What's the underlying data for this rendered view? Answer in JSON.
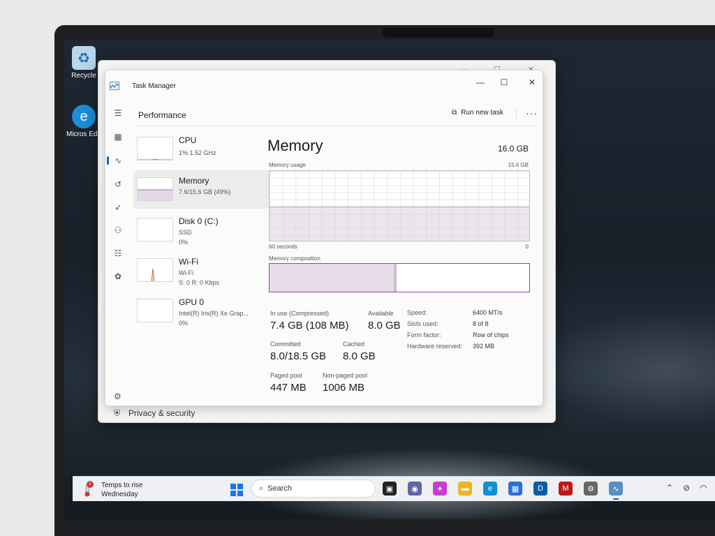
{
  "desktop": {
    "icons": [
      {
        "label": "Recycle",
        "icon": "recycle-bin-icon"
      },
      {
        "label": "Micros Edg",
        "icon": "edge-icon"
      }
    ]
  },
  "ghost_window": {
    "footer_label": "Privacy & security",
    "footer_icon": "shield-icon"
  },
  "window": {
    "title": "Task Manager",
    "app_icon": "task-manager-icon",
    "controls": [
      "minimize-icon",
      "maximize-icon",
      "close-icon"
    ]
  },
  "header": {
    "title": "Performance",
    "run_new_task": "Run new task",
    "more": "···"
  },
  "nav": [
    {
      "name": "hamburger-menu-icon",
      "glyph": "☰"
    },
    {
      "name": "processes-icon",
      "glyph": "▦"
    },
    {
      "name": "performance-icon",
      "glyph": "∿",
      "active": true
    },
    {
      "name": "app-history-icon",
      "glyph": "↺"
    },
    {
      "name": "startup-apps-icon",
      "glyph": "➶"
    },
    {
      "name": "users-icon",
      "glyph": "⚇"
    },
    {
      "name": "details-icon",
      "glyph": "☷"
    },
    {
      "name": "services-icon",
      "glyph": "✿"
    }
  ],
  "settings_icon": "⚙",
  "sidebar": [
    {
      "name": "CPU",
      "line1": "1%  1.52 GHz",
      "line2": ""
    },
    {
      "name": "Memory",
      "line1": "7.6/15.6 GB (49%)",
      "line2": "",
      "selected": true
    },
    {
      "name": "Disk 0 (C:)",
      "line1": "SSD",
      "line2": "0%"
    },
    {
      "name": "Wi-Fi",
      "line1": "Wi-Fi",
      "line2": "S: 0  R: 0 Kbps"
    },
    {
      "name": "GPU 0",
      "line1": "Intel(R) Iris(R) Xe Grap...",
      "line2": "0%"
    }
  ],
  "memory": {
    "title": "Memory",
    "total": "16.0 GB",
    "usage_label": "Memory usage",
    "usage_max": "15.6 GB",
    "usage_fraction": 0.49,
    "time_label": "60 seconds",
    "zero_label": "0",
    "composition_label": "Memory composition",
    "composition_used_fraction": 0.49,
    "stats": {
      "in_use_label": "In use (Compressed)",
      "in_use_value": "7.4 GB (108 MB)",
      "available_label": "Available",
      "available_value": "8.0 GB",
      "committed_label": "Committed",
      "committed_value": "8.0/18.5 GB",
      "cached_label": "Cached",
      "cached_value": "8.0 GB",
      "paged_label": "Paged pool",
      "paged_value": "447 MB",
      "nonpaged_label": "Non-paged pool",
      "nonpaged_value": "1006 MB"
    },
    "specs": [
      {
        "label": "Speed:",
        "value": "6400 MT/s"
      },
      {
        "label": "Slots used:",
        "value": "8 of 8"
      },
      {
        "label": "Form factor:",
        "value": "Row of chips"
      },
      {
        "label": "Hardware reserved:",
        "value": "392 MB"
      }
    ]
  },
  "taskbar": {
    "weather_line1": "Temps to rise",
    "weather_line2": "Wednesday",
    "weather_badge": "1",
    "search_placeholder": "Search",
    "apps": [
      {
        "name": "task-view-icon",
        "color": "#222"
      },
      {
        "name": "teams-icon",
        "color": "#6264a7"
      },
      {
        "name": "copilot-icon",
        "color": "#c43fd1"
      },
      {
        "name": "file-explorer-icon",
        "color": "#f2b324"
      },
      {
        "name": "edge-icon",
        "color": "#0f8fd6"
      },
      {
        "name": "store-icon",
        "color": "#2a6fd9"
      },
      {
        "name": "dell-icon",
        "color": "#0a5ea8"
      },
      {
        "name": "mcafee-icon",
        "color": "#c01818"
      },
      {
        "name": "settings-icon",
        "color": "#666"
      },
      {
        "name": "task-manager-icon",
        "color": "#5a8fc6",
        "active": true
      }
    ],
    "tray": [
      "chevron-up-icon",
      "network-off-icon",
      "wifi-icon"
    ]
  }
}
